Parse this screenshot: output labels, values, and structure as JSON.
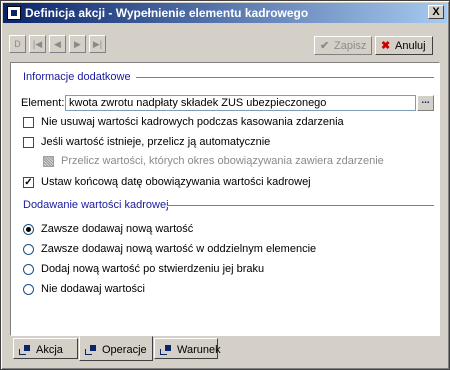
{
  "window": {
    "title": "Definicja akcji - Wypełnienie elementu kadrowego",
    "close_glyph": "X"
  },
  "toolbar": {
    "nav_buttons": [
      {
        "name": "first-record-button",
        "glyph": "D"
      },
      {
        "name": "prev-page-button",
        "glyph": "|◀"
      },
      {
        "name": "prev-record-button",
        "glyph": "◀"
      },
      {
        "name": "next-record-button",
        "glyph": "▶"
      },
      {
        "name": "last-record-button",
        "glyph": "▶|"
      }
    ],
    "save_label": "Zapisz",
    "save_icon": "check-icon",
    "cancel_label": "Anuluj",
    "cancel_icon": "x-icon"
  },
  "info_section": {
    "title": "Informacje dodatkowe",
    "element_label": "Element:",
    "element_value": "kwota zwrotu nadpłaty składek ZUS ubezpieczonego",
    "browse_label": "...",
    "options": [
      {
        "label": "Nie usuwaj wartości kadrowych podczas kasowania zdarzenia",
        "checked": false,
        "enabled": true
      },
      {
        "label": "Jeśli wartość istnieje, przelicz ją automatycznie",
        "checked": false,
        "enabled": true
      },
      {
        "label": "Przelicz wartości, których okres obowiązywania zawiera zdarzenie",
        "checked": false,
        "enabled": false
      },
      {
        "label": "Ustaw końcową datę obowiązywania wartości kadrowej",
        "checked": true,
        "enabled": true
      }
    ]
  },
  "add_section": {
    "title": "Dodawanie wartości kadrowej",
    "radios": [
      {
        "label": "Zawsze dodawaj nową wartość",
        "checked": true
      },
      {
        "label": "Zawsze dodawaj nową wartość w oddzielnym elemencie",
        "checked": false
      },
      {
        "label": "Dodaj nową wartość po stwierdzeniu jej braku",
        "checked": false
      },
      {
        "label": "Nie dodawaj wartości",
        "checked": false
      }
    ]
  },
  "tabs": [
    {
      "label": "Akcja",
      "active": false
    },
    {
      "label": "Operacje",
      "active": true
    },
    {
      "label": "Warunek",
      "active": false
    }
  ],
  "colors": {
    "title_gradient_start": "#0a246a",
    "title_gradient_end": "#a6caf0",
    "section_title": "#1a1aa0",
    "cancel_icon": "#cc0000",
    "save_icon_disabled": "#8c8c8c"
  }
}
